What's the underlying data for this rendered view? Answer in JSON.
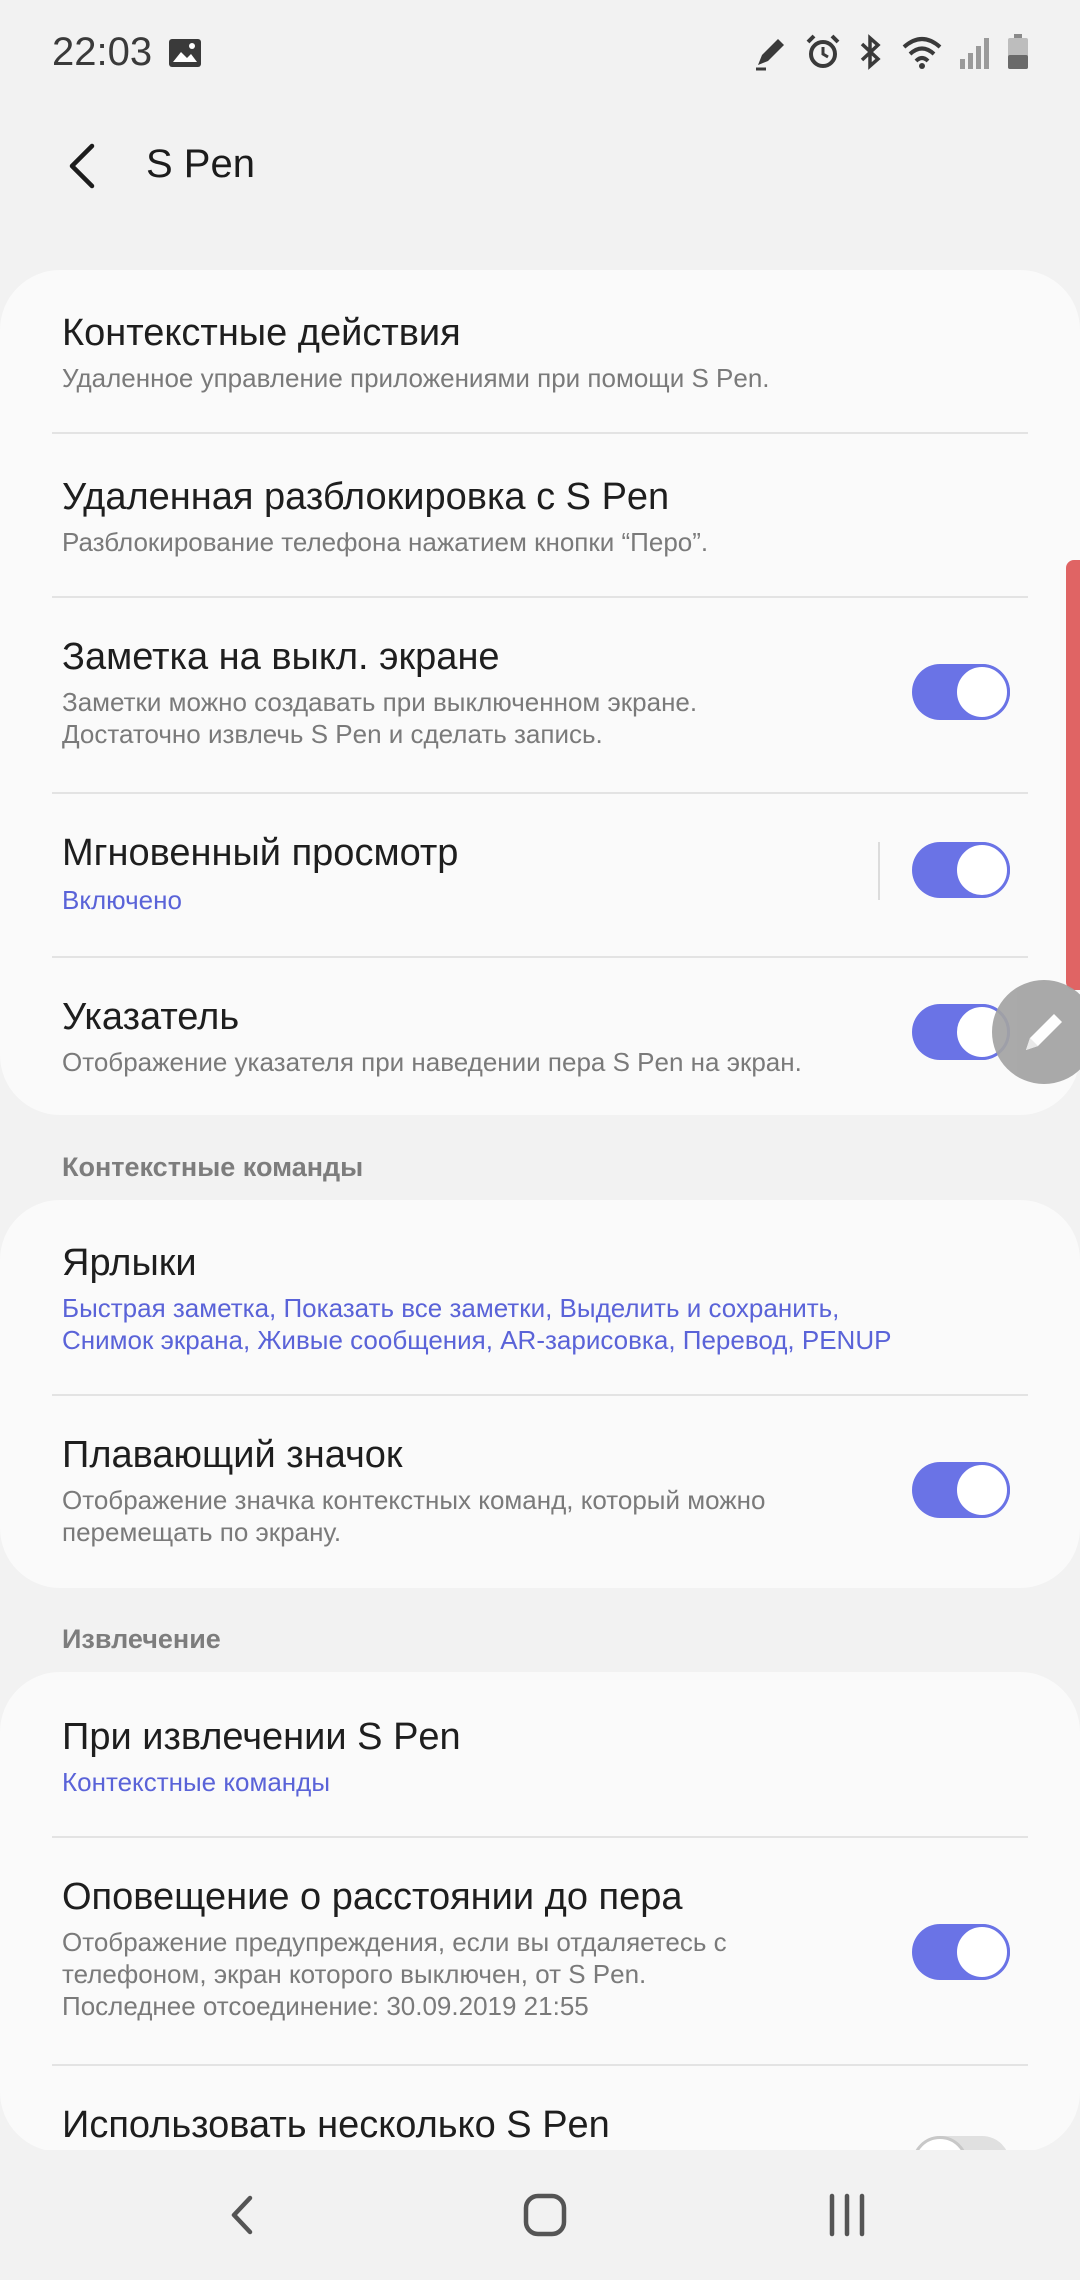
{
  "status": {
    "time": "22:03"
  },
  "header": {
    "title": "S Pen"
  },
  "card1": {
    "items": [
      {
        "title": "Контекстные действия",
        "subtitle": "Удаленное управление приложениями при помощи S Pen."
      },
      {
        "title": "Удаленная разблокировка с S Pen",
        "subtitle": "Разблокирование телефона нажатием кнопки “Перо”."
      },
      {
        "title": "Заметка на выкл. экране",
        "subtitle_line1": "Заметки можно создавать при выключенном экране.",
        "subtitle_line2": "Достаточно извлечь S Pen и сделать запись.",
        "toggle": true
      },
      {
        "title": "Мгновенный просмотр",
        "subtitle": "Включено",
        "toggle": true
      },
      {
        "title": "Указатель",
        "subtitle": "Отображение указателя при наведении пера S Pen на экран.",
        "toggle": true
      }
    ]
  },
  "section2": {
    "header": "Контекстные команды"
  },
  "card2": {
    "items": [
      {
        "title": "Ярлыки",
        "subtitle_line1": "Быстрая заметка, Показать все заметки, Выделить и сохранить,",
        "subtitle_line2": "Снимок экрана, Живые сообщения, AR-зарисовка, Перевод, PENUP"
      },
      {
        "title": "Плавающий значок",
        "subtitle_line1": "Отображение значка контекстных команд, который можно",
        "subtitle_line2": "перемещать по экрану.",
        "toggle": true
      }
    ]
  },
  "section3": {
    "header": "Извлечение"
  },
  "card3": {
    "items": [
      {
        "title": "При извлечении S Pen",
        "subtitle": "Контекстные команды"
      },
      {
        "title": "Оповещение о расстоянии до пера",
        "subtitle_line1": "Отображение предупреждения, если вы отдаляетесь с",
        "subtitle_line2": "телефоном, экран которого выключен, от S Pen.",
        "subtitle_line3": "Последнее отсоединение: 30.09.2019  21:55",
        "toggle": true
      },
      {
        "title": "Использовать несколько S Pen",
        "toggle": false
      }
    ]
  },
  "colors": {
    "accent": "#6a73e6",
    "link": "#5a63d8",
    "background": "#f2f2f2",
    "card": "#fafafa"
  }
}
